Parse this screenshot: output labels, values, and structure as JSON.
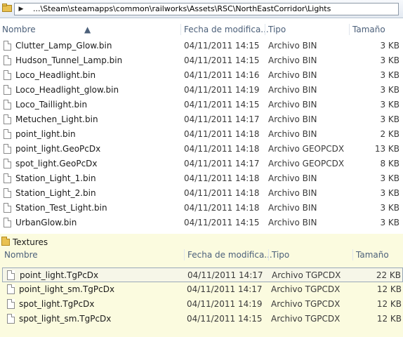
{
  "address": {
    "path": "...\\Steam\\steamapps\\common\\railworks\\Assets\\RSC\\NorthEastCorridor\\Lights"
  },
  "columns": {
    "name": "Nombre",
    "date": "Fecha de modifica...",
    "type": "Tipo",
    "size": "Tamaño"
  },
  "files": [
    {
      "name": "Clutter_Lamp_Glow.bin",
      "date": "04/11/2011 14:15",
      "type": "Archivo BIN",
      "size": "3 KB"
    },
    {
      "name": "Hudson_Tunnel_Lamp.bin",
      "date": "04/11/2011 14:15",
      "type": "Archivo BIN",
      "size": "3 KB"
    },
    {
      "name": "Loco_Headlight.bin",
      "date": "04/11/2011 14:16",
      "type": "Archivo BIN",
      "size": "3 KB"
    },
    {
      "name": "Loco_Headlight_glow.bin",
      "date": "04/11/2011 14:19",
      "type": "Archivo BIN",
      "size": "3 KB"
    },
    {
      "name": "Loco_Taillight.bin",
      "date": "04/11/2011 14:15",
      "type": "Archivo BIN",
      "size": "3 KB"
    },
    {
      "name": "Metuchen_Light.bin",
      "date": "04/11/2011 14:17",
      "type": "Archivo BIN",
      "size": "3 KB"
    },
    {
      "name": "point_light.bin",
      "date": "04/11/2011 14:18",
      "type": "Archivo BIN",
      "size": "2 KB"
    },
    {
      "name": "point_light.GeoPcDx",
      "date": "04/11/2011 14:18",
      "type": "Archivo GEOPCDX",
      "size": "13 KB"
    },
    {
      "name": "spot_light.GeoPcDx",
      "date": "04/11/2011 14:17",
      "type": "Archivo GEOPCDX",
      "size": "8 KB"
    },
    {
      "name": "Station_Light_1.bin",
      "date": "04/11/2011 14:18",
      "type": "Archivo BIN",
      "size": "3 KB"
    },
    {
      "name": "Station_Light_2.bin",
      "date": "04/11/2011 14:18",
      "type": "Archivo BIN",
      "size": "3 KB"
    },
    {
      "name": "Station_Test_Light.bin",
      "date": "04/11/2011 14:18",
      "type": "Archivo BIN",
      "size": "3 KB"
    },
    {
      "name": "UrbanGlow.bin",
      "date": "04/11/2011 14:15",
      "type": "Archivo BIN",
      "size": "3 KB"
    }
  ],
  "textures": {
    "folder": "Textures",
    "files": [
      {
        "name": "point_light.TgPcDx",
        "date": "04/11/2011 14:17",
        "type": "Archivo TGPCDX",
        "size": "22 KB"
      },
      {
        "name": "point_light_sm.TgPcDx",
        "date": "04/11/2011 14:17",
        "type": "Archivo TGPCDX",
        "size": "12 KB"
      },
      {
        "name": "spot_light.TgPcDx",
        "date": "04/11/2011 14:19",
        "type": "Archivo TGPCDX",
        "size": "12 KB"
      },
      {
        "name": "spot_light_sm.TgPcDx",
        "date": "04/11/2011 14:15",
        "type": "Archivo TGPCDX",
        "size": "12 KB"
      }
    ]
  }
}
